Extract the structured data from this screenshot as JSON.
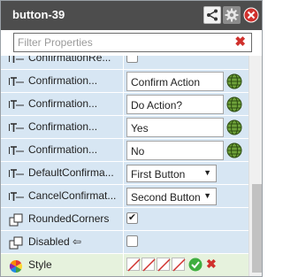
{
  "panel": {
    "title": "button-39",
    "filter_placeholder": "Filter Properties",
    "clear_symbol": "✖"
  },
  "rows": [
    {
      "label": "ConfirmationRe...",
      "icon": "text-property-icon",
      "value_type": "checkbox",
      "checked": false
    },
    {
      "label": "Confirmation...",
      "icon": "text-property-icon",
      "value_type": "text",
      "value": "Confirm Action"
    },
    {
      "label": "Confirmation...",
      "icon": "text-property-icon",
      "value_type": "text",
      "value": "Do Action?"
    },
    {
      "label": "Confirmation...",
      "icon": "text-property-icon",
      "value_type": "text",
      "value": "Yes"
    },
    {
      "label": "Confirmation...",
      "icon": "text-property-icon",
      "value_type": "text",
      "value": "No"
    },
    {
      "label": "DefaultConfirma...",
      "icon": "text-property-icon",
      "value_type": "select",
      "value": "First Button"
    },
    {
      "label": "CancelConfirmat...",
      "icon": "text-property-icon",
      "value_type": "select",
      "value": "Second Button"
    },
    {
      "label": "RoundedCorners",
      "icon": "style-property-icon",
      "value_type": "checkbox",
      "checked": true
    },
    {
      "label": "Disabled ⇦",
      "icon": "style-property-icon",
      "value_type": "checkbox",
      "checked": false
    },
    {
      "label": "Style",
      "icon": "color-wheel-icon",
      "value_type": "style"
    }
  ],
  "checkmark": "✔",
  "select_arrow": "▼",
  "colors": {
    "titlebar": "#4d4d4d",
    "row_bg": "#d7e6f3",
    "style_row_bg": "#e6f2dd",
    "clear_red": "#d0312d"
  }
}
